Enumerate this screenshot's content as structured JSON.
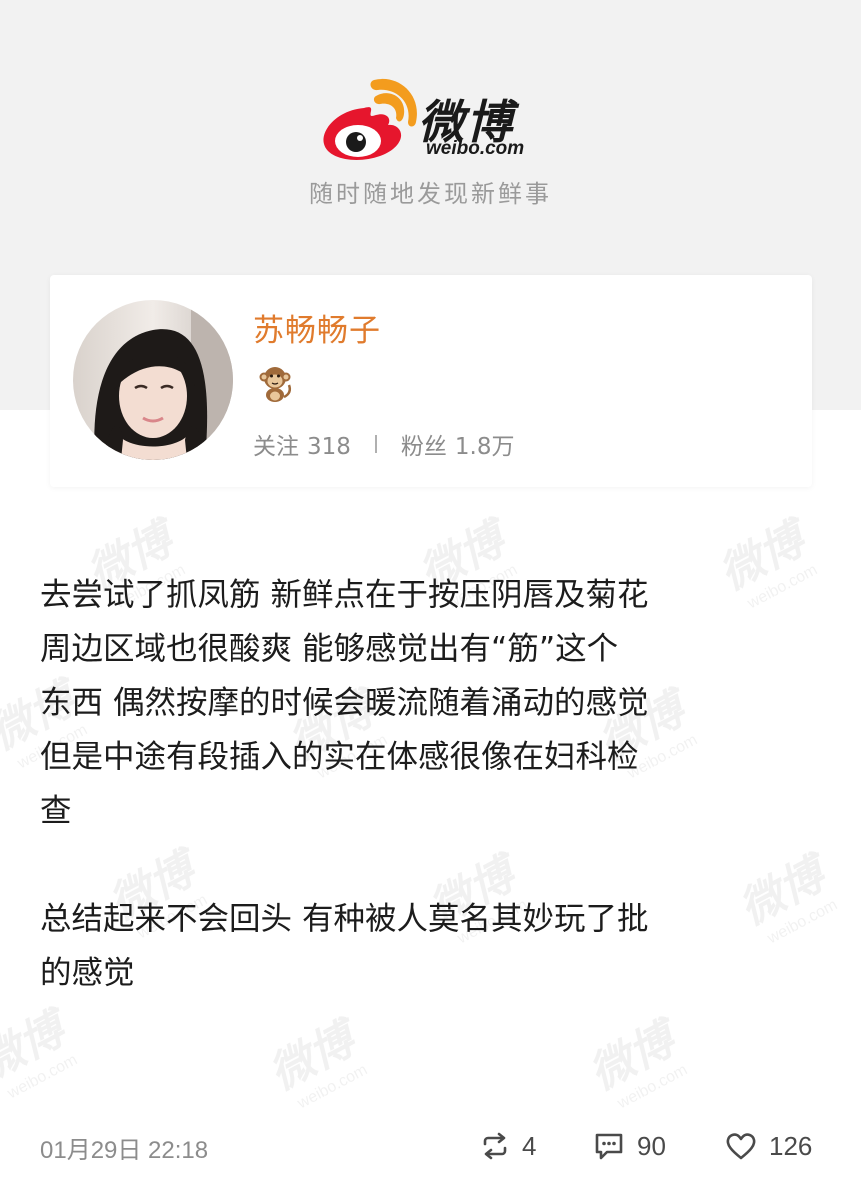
{
  "header": {
    "logo_text": "微博",
    "logo_domain": "weibo.com",
    "tagline": "随时随地发现新鲜事"
  },
  "profile": {
    "username": "苏畅畅子",
    "badge_icon": "monkey-icon",
    "following_label": "关注",
    "following_count": "318",
    "followers_label": "粉丝",
    "followers_count": "1.8万"
  },
  "post": {
    "lines": [
      "去尝试了抓凤筋 新鲜点在于按压阴唇及菊花",
      "周边区域也很酸爽 能够感觉出有“筋”这个",
      "东西 偶然按摩的时候会暖流随着涌动的感觉",
      "但是中途有段插入的实在体感很像在妇科检",
      "查",
      "",
      "总结起来不会回头 有种被人莫名其妙玩了批",
      "的感觉"
    ]
  },
  "footer": {
    "timestamp": "01月29日 22:18",
    "repost_count": "4",
    "comment_count": "90",
    "like_count": "126"
  },
  "watermark": {
    "text": "微博",
    "domain": "weibo.com"
  },
  "colors": {
    "username": "#e07b2d",
    "logo_red": "#e6162d",
    "logo_orange": "#f39c1e",
    "header_bg": "#f2f2f2"
  }
}
